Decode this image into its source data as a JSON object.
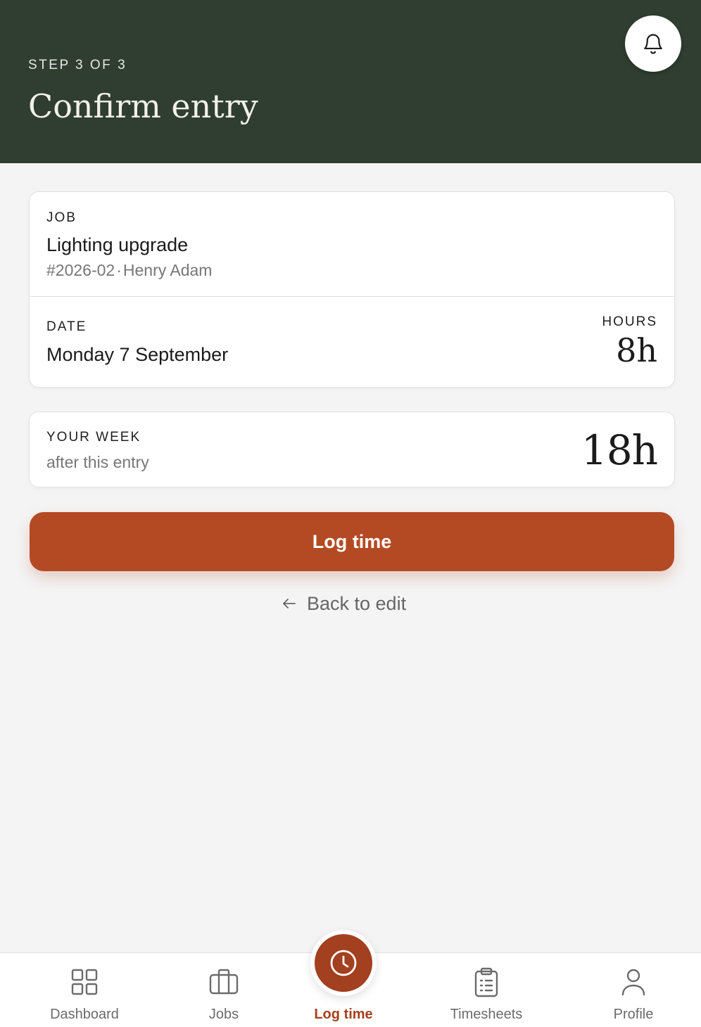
{
  "header": {
    "step": "STEP 3 OF 3",
    "title": "Confirm entry",
    "notifications_icon": "bell-icon"
  },
  "job_card": {
    "job_label": "JOB",
    "job_name": "Lighting upgrade",
    "job_number": "#2026-02",
    "separator": "·",
    "client": "Henry Adam",
    "date_label": "DATE",
    "date_value": "Monday 7 September",
    "hours_label": "HOURS",
    "hours_value": "8h"
  },
  "week_card": {
    "label": "YOUR WEEK",
    "sub": "after this entry",
    "value": "18h"
  },
  "actions": {
    "primary": "Log time",
    "back": "Back to edit"
  },
  "nav": {
    "items": [
      {
        "label": "Dashboard",
        "icon": "grid-icon"
      },
      {
        "label": "Jobs",
        "icon": "briefcase-icon"
      },
      {
        "label": "Log time",
        "icon": "clock-icon",
        "active": true
      },
      {
        "label": "Timesheets",
        "icon": "clipboard-icon"
      },
      {
        "label": "Profile",
        "icon": "user-icon"
      }
    ]
  },
  "colors": {
    "header_bg": "#2f3e31",
    "accent": "#b44a24",
    "active_nav": "#a5401e",
    "page_bg": "#f4f4f4"
  }
}
